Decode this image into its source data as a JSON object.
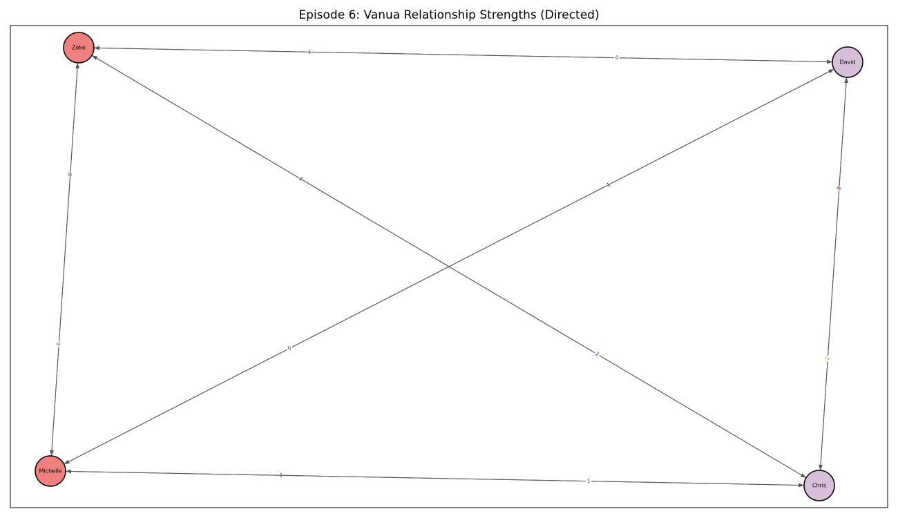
{
  "title": "Episode 6: Vanua Relationship Strengths (Directed)",
  "colors": {
    "zeke": "#f08080",
    "michelle": "#f08080",
    "david": "#d8bfd8",
    "chris": "#d8bfd8",
    "label_blue": "#0000cc",
    "label_red": "#cc0000",
    "label_dark": "#333333",
    "label_olive": "#999900",
    "edge": "#555555"
  },
  "nodes": [
    {
      "id": "zeke",
      "label": "Zeke"
    },
    {
      "id": "david",
      "label": "David"
    },
    {
      "id": "michelle",
      "label": "Michelle"
    },
    {
      "id": "chris",
      "label": "Chris"
    }
  ],
  "edges": [
    {
      "from": "david",
      "to": "zeke",
      "value": "1"
    },
    {
      "from": "zeke",
      "to": "david",
      "value": "0"
    },
    {
      "from": "michelle",
      "to": "zeke",
      "value": "0"
    },
    {
      "from": "zeke",
      "to": "michelle",
      "value": "0"
    },
    {
      "from": "chris",
      "to": "zeke",
      "value": "2"
    },
    {
      "from": "zeke",
      "to": "chris",
      "value": "2"
    },
    {
      "from": "michelle",
      "to": "david",
      "value": "1"
    },
    {
      "from": "david",
      "to": "michelle",
      "value": "0"
    },
    {
      "from": "chris",
      "to": "david",
      "value": "-2"
    },
    {
      "from": "david",
      "to": "chris",
      "value": "2"
    },
    {
      "from": "chris",
      "to": "michelle",
      "value": "1"
    },
    {
      "from": "michelle",
      "to": "chris",
      "value": "1"
    }
  ]
}
